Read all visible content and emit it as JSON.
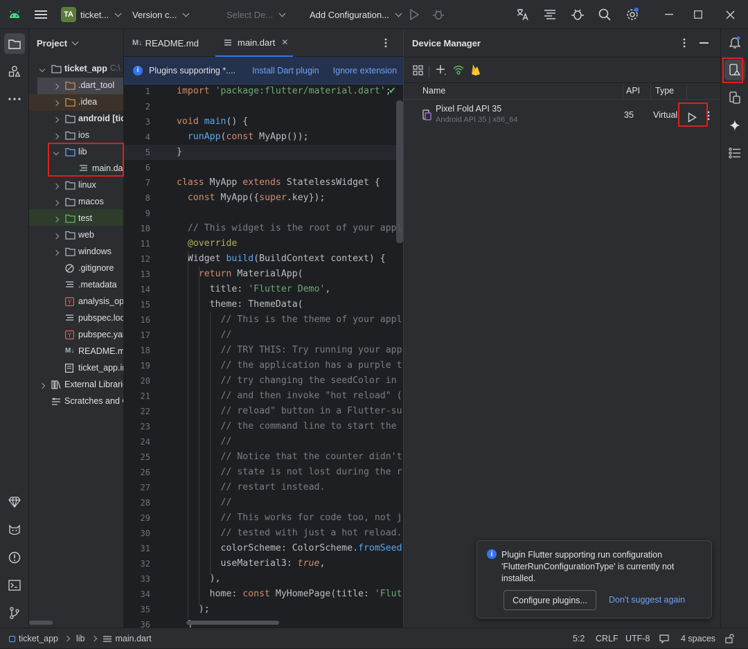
{
  "titlebar": {
    "project_badge": "TA",
    "project_name": "ticket...",
    "vcs": "Version c...",
    "device_select": "Select De...",
    "run_config": "Add Configuration..."
  },
  "project_panel": {
    "title": "Project",
    "root": {
      "name": "ticket_app",
      "path": "C:\\"
    },
    "items": [
      {
        "label": "ticket_app",
        "suffix": "C:\\"
      },
      {
        "label": ".dart_tool"
      },
      {
        "label": ".idea"
      },
      {
        "label": "android [ticl"
      },
      {
        "label": "ios"
      },
      {
        "label": "lib"
      },
      {
        "label": "main.da"
      },
      {
        "label": "linux"
      },
      {
        "label": "macos"
      },
      {
        "label": "test"
      },
      {
        "label": "web"
      },
      {
        "label": "windows"
      },
      {
        "label": ".gitignore"
      },
      {
        "label": ".metadata"
      },
      {
        "label": "analysis_opt"
      },
      {
        "label": "pubspec.loc"
      },
      {
        "label": "pubspec.yar"
      },
      {
        "label": "README.mc"
      },
      {
        "label": "ticket_app.in"
      },
      {
        "label": "External Librarie"
      },
      {
        "label": "Scratches and C"
      }
    ]
  },
  "editor": {
    "tabs": [
      {
        "label": "README.md",
        "icon": "M↓"
      },
      {
        "label": "main.dart"
      }
    ],
    "banner": {
      "text": "Plugins supporting *....",
      "install": "Install Dart plugin",
      "ignore": "Ignore extension"
    },
    "line_numbers": [
      "1",
      "2",
      "3",
      "4",
      "5",
      "6",
      "7",
      "8",
      "9",
      "10",
      "11",
      "12",
      "13",
      "14",
      "15",
      "16",
      "17",
      "18",
      "19",
      "20",
      "21",
      "22",
      "23",
      "24",
      "25",
      "26",
      "27",
      "28",
      "29",
      "30",
      "31",
      "32",
      "33",
      "34",
      "35",
      "36"
    ]
  },
  "device_manager": {
    "title": "Device Manager",
    "columns": {
      "name": "Name",
      "api": "API",
      "type": "Type"
    },
    "device": {
      "name": "Pixel Fold API 35",
      "subtitle": "Android API 35 | x86_64",
      "api": "35",
      "type": "Virtual"
    }
  },
  "notification": {
    "text_line1": "Plugin Flutter supporting run configuration",
    "text_line2": "'FlutterRunConfigurationType' is currently not",
    "text_line3": "installed.",
    "configure_button": "Configure plugins...",
    "dont_suggest": "Don't suggest again"
  },
  "statusbar": {
    "crumb_project": "ticket_app",
    "crumb_dir": "lib",
    "crumb_file": "main.dart",
    "position": "5:2",
    "line_sep": "CRLF",
    "encoding": "UTF-8",
    "indent": "4 spaces"
  },
  "colors": {
    "accent": "#3574f0",
    "highlight_red": "#e0201b",
    "android_green": "#3ddc84"
  }
}
